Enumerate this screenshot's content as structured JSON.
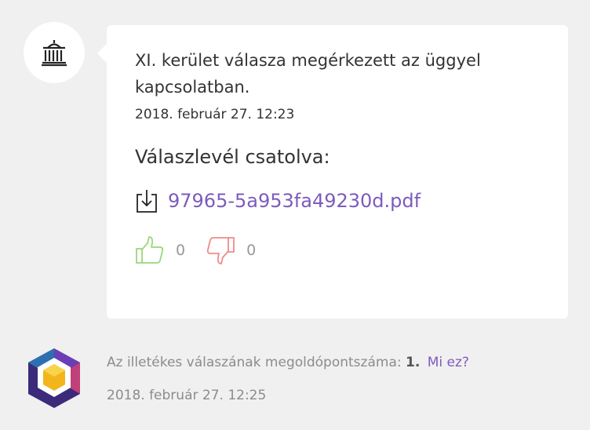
{
  "message": {
    "text": "XI. kerület válasza megérkezett az üggyel kapcsolatban.",
    "date": "2018. február 27. 12:23",
    "attachment_heading": "Válaszlevél csatolva:",
    "attachment_filename": "97965-5a953fa49230d.pdf"
  },
  "votes": {
    "up_count": "0",
    "down_count": "0",
    "up_color": "#9ad67a",
    "down_color": "#f08a8a"
  },
  "score": {
    "label": "Az illetékes válaszának megoldópontszáma:",
    "value": "1.",
    "help_link": "Mi ez?",
    "date": "2018. február 27. 12:25"
  },
  "colors": {
    "accent": "#7d5bbe",
    "background": "#f0f0f0"
  }
}
